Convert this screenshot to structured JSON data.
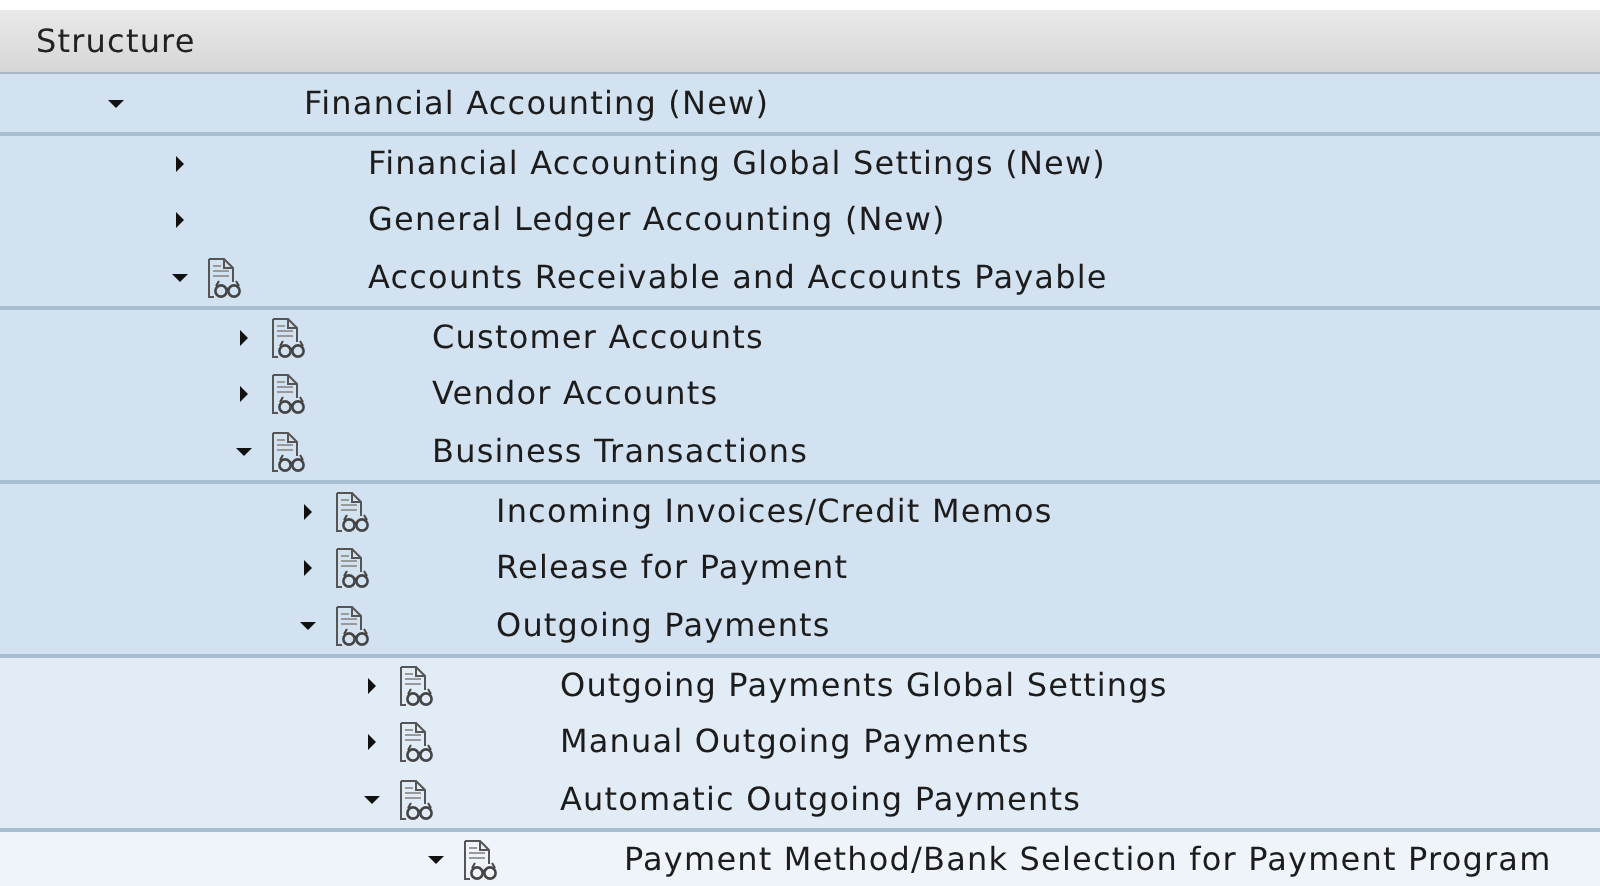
{
  "header": {
    "title": "Structure"
  },
  "tree": [
    {
      "label": "Financial Accounting (New)",
      "kind": "node",
      "expanded": true,
      "children": [
        {
          "label": "Financial Accounting Global Settings (New)",
          "kind": "node",
          "expanded": false
        },
        {
          "label": "General Ledger Accounting (New)",
          "kind": "node",
          "expanded": false
        },
        {
          "label": "Accounts Receivable and Accounts Payable",
          "kind": "document",
          "expanded": true,
          "children": [
            {
              "label": "Customer Accounts",
              "kind": "document",
              "expanded": false
            },
            {
              "label": "Vendor Accounts",
              "kind": "document",
              "expanded": false
            },
            {
              "label": "Business Transactions",
              "kind": "document",
              "expanded": true,
              "children": [
                {
                  "label": "Incoming Invoices/Credit Memos",
                  "kind": "document",
                  "expanded": false
                },
                {
                  "label": "Release for Payment",
                  "kind": "document",
                  "expanded": false
                },
                {
                  "label": "Outgoing Payments",
                  "kind": "document",
                  "expanded": true,
                  "children": [
                    {
                      "label": "Outgoing Payments Global Settings",
                      "kind": "document",
                      "expanded": false
                    },
                    {
                      "label": "Manual Outgoing Payments",
                      "kind": "document",
                      "expanded": false
                    },
                    {
                      "label": "Automatic Outgoing Payments",
                      "kind": "document",
                      "expanded": true,
                      "children": [
                        {
                          "label": "Payment Method/Bank Selection for Payment Program",
                          "kind": "document",
                          "expanded": true
                        }
                      ]
                    }
                  ]
                }
              ]
            }
          ]
        }
      ]
    }
  ]
}
